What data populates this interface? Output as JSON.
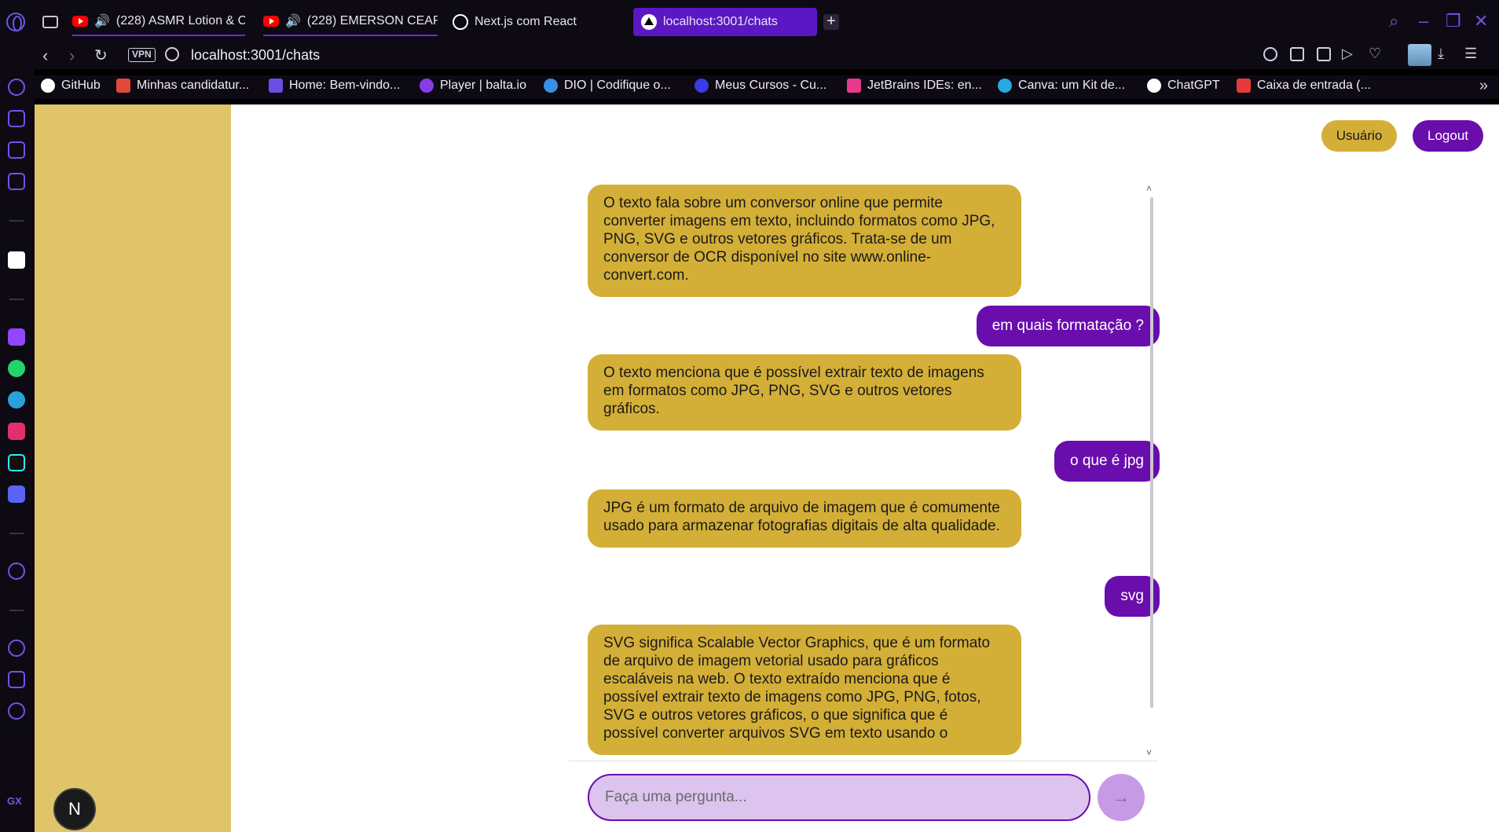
{
  "browser": {
    "tabs": [
      {
        "label": "(228) ASMR Lotion & C",
        "icon": "youtube-icon"
      },
      {
        "label": "(228) EMERSON CEAR",
        "icon": "youtube-icon"
      },
      {
        "label": "Next.js com React",
        "icon": "globe-icon"
      },
      {
        "label": "localhost:3001/chats",
        "icon": "nextjs-icon"
      }
    ],
    "new_tab": "+",
    "vpn_label": "VPN",
    "url": "localhost:3001/chats",
    "bookmarks": [
      {
        "label": "GitHub",
        "color": "#ffffff"
      },
      {
        "label": "Minhas candidatur...",
        "color": "#e04a3a"
      },
      {
        "label": "Home: Bem-vindo...",
        "color": "#6b4de6"
      },
      {
        "label": "Player | balta.io",
        "color": "#8a3ce6"
      },
      {
        "label": "DIO | Codifique o...",
        "color": "#3a8ee6"
      },
      {
        "label": "Meus Cursos - Cu...",
        "color": "#3a3ae6"
      },
      {
        "label": "JetBrains IDEs: en...",
        "color": "#e63a8a"
      },
      {
        "label": "Canva: um Kit de...",
        "color": "#2aa8e0"
      },
      {
        "label": "ChatGPT",
        "color": "#ffffff"
      },
      {
        "label": "Caixa de entrada (...",
        "color": "#e63a3a"
      }
    ],
    "gx_label": "GX"
  },
  "header": {
    "user_button": "Usuário",
    "logout_button": "Logout"
  },
  "chat": {
    "messages": [
      {
        "role": "bot",
        "text": "O texto fala sobre um conversor online que permite converter imagens em texto, incluindo formatos como JPG, PNG, SVG e outros vetores gráficos. Trata-se de um conversor de OCR disponível no site www.online-convert.com."
      },
      {
        "role": "user",
        "text": "em quais formatação ?"
      },
      {
        "role": "bot",
        "text": "O texto menciona que é possível extrair texto de imagens em formatos como JPG, PNG, SVG e outros vetores gráficos."
      },
      {
        "role": "user",
        "text": "o que é jpg"
      },
      {
        "role": "bot",
        "text": "JPG é um formato de arquivo de imagem que é comumente usado para armazenar fotografias digitais de alta qualidade."
      },
      {
        "role": "user",
        "text": "svg"
      },
      {
        "role": "bot",
        "text": "SVG significa Scalable Vector Graphics, que é um formato de arquivo de imagem vetorial usado para gráficos escaláveis na web. O texto extraído menciona que é possível extrair texto de imagens como JPG, PNG, fotos, SVG e outros vetores gráficos, o que significa que é possível converter arquivos SVG em texto usando o"
      }
    ],
    "input_placeholder": "Faça uma pergunta...",
    "send_icon": "arrow-right-icon"
  },
  "sidebar": {
    "avatar_initial": "N"
  },
  "colors": {
    "sidebar": "#e0c46a",
    "bot_bubble": "#d4af37",
    "user_bubble": "#6a0dad",
    "input_bg": "#dcc4ef",
    "send_btn": "#c79ae6"
  }
}
